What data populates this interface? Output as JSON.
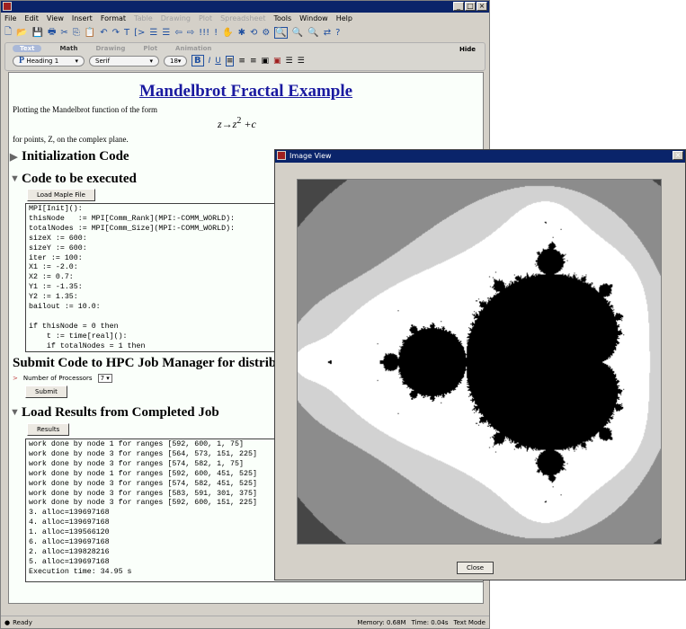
{
  "main_window": {
    "menu": [
      {
        "label": "File"
      },
      {
        "label": "Edit"
      },
      {
        "label": "View"
      },
      {
        "label": "Insert"
      },
      {
        "label": "Format"
      },
      {
        "label": "Table",
        "disabled": true
      },
      {
        "label": "Drawing",
        "disabled": true
      },
      {
        "label": "Plot",
        "disabled": true
      },
      {
        "label": "Spreadsheet",
        "disabled": true
      },
      {
        "label": "Tools"
      },
      {
        "label": "Window"
      },
      {
        "label": "Help"
      }
    ],
    "palette_tabs": [
      "Text",
      "Math",
      "Drawing",
      "Plot",
      "Animation"
    ],
    "hide_label": "Hide",
    "style_select": "Heading 1",
    "font_select": "Serif",
    "size_select": "18",
    "bold": "B",
    "italic": "I",
    "underline": "U"
  },
  "document": {
    "title": "Mandelbrot Fractal Example",
    "intro": "Plotting the Mandelbrot function of the form",
    "formula": "z→z",
    "formula_exp": "2",
    "formula_tail": "+c",
    "points_text": "for points, Z, on the complex plane.",
    "sections": {
      "init": "Initialization Code",
      "code": "Code to be executed",
      "submit": "Submit Code to HPC Job Manager for distribut",
      "results": "Load Results from Completed Job"
    },
    "load_button": "Load Maple File",
    "code_lines": "MPI[Init]():\nthisNode   := MPI[Comm_Rank](MPI:-COMM_WORLD):\ntotalNodes := MPI[Comm_Size](MPI:-COMM_WORLD):\nsizeX := 600:\nsizeY := 600:\niter := 100:\nX1 := -2.0:\nX2 := 0.7:\nY1 := -1.35:\nY2 := 1.35:\nbailout := 10.0:\n\nif thisNode = 0 then\n    t := time[real]():\n    if totalNodes = 1 then",
    "processors_label": "Number of Processors",
    "processors_value": "7",
    "submit_button": "Submit",
    "results_button": "Results",
    "output_lines": "work done by node 1 for ranges [592, 600, 1, 75]\nwork done by node 3 for ranges [564, 573, 151, 225]\nwork done by node 3 for ranges [574, 582, 1, 75]\nwork done by node 1 for ranges [592, 600, 451, 525]\nwork done by node 3 for ranges [574, 582, 451, 525]\nwork done by node 3 for ranges [583, 591, 301, 375]\nwork done by node 3 for ranges [592, 600, 151, 225]\n3. alloc=139697168\n4. alloc=139697168\n1. alloc=139566120\n6. alloc=139697168\n2. alloc=139828216\n5. alloc=139697168\nExecution time: 34.95 s"
  },
  "status": {
    "ready": "Ready",
    "memory": "Memory: 0.68M",
    "time": "Time: 0.04s",
    "mode": "Text Mode"
  },
  "image_view": {
    "title": "Image View",
    "close_button": "Close",
    "colors": {
      "set": "#000000",
      "outer": "#00ff00"
    }
  }
}
